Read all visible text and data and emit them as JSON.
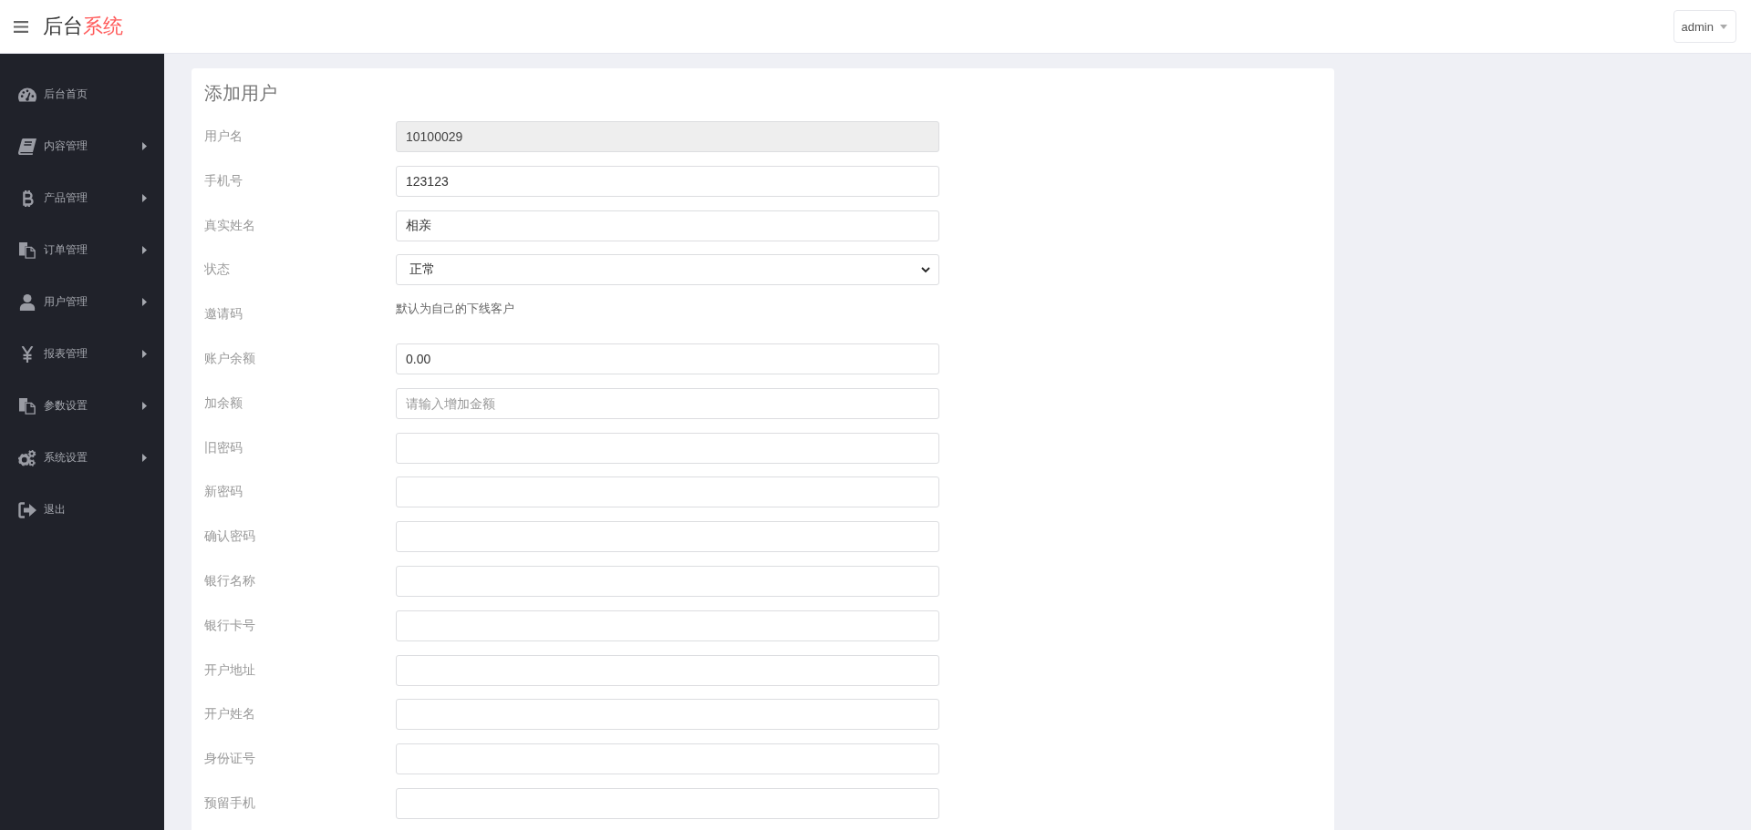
{
  "header": {
    "logo": {
      "text": "后台",
      "accent": "系统"
    },
    "user_menu": {
      "label": "admin"
    }
  },
  "sidebar": {
    "items": [
      {
        "label": "后台首页",
        "kind": "link"
      },
      {
        "label": "内容管理",
        "kind": "submenu"
      },
      {
        "label": "产品管理",
        "kind": "submenu"
      },
      {
        "label": "订单管理",
        "kind": "submenu"
      },
      {
        "label": "用户管理",
        "kind": "submenu"
      },
      {
        "label": "报表管理",
        "kind": "submenu"
      },
      {
        "label": "参数设置",
        "kind": "submenu"
      },
      {
        "label": "系统设置",
        "kind": "submenu"
      },
      {
        "label": "退出",
        "kind": "link"
      }
    ]
  },
  "form": {
    "title": "添加用户",
    "fields": [
      {
        "label": "用户名",
        "kind": "input",
        "value": "10100029",
        "disabled": true
      },
      {
        "label": "手机号",
        "kind": "input",
        "value": "123123",
        "disabled": false
      },
      {
        "label": "真实姓名",
        "kind": "input",
        "value": "相亲",
        "disabled": false
      },
      {
        "label": "状态",
        "kind": "select",
        "value": "正常",
        "disabled": false
      },
      {
        "label": "邀请码",
        "kind": "note",
        "text": "默认为自己的下线客户"
      },
      {
        "label": "账户余额",
        "kind": "input",
        "value": "0.00",
        "disabled": false
      },
      {
        "label": "加余额",
        "kind": "input",
        "placeholder": "请输入增加金额",
        "disabled": false
      },
      {
        "label": "旧密码",
        "kind": "input",
        "disabled": false
      },
      {
        "label": "新密码",
        "kind": "input",
        "disabled": false
      },
      {
        "label": "确认密码",
        "kind": "input",
        "disabled": false
      },
      {
        "label": "银行名称",
        "kind": "input",
        "disabled": false
      },
      {
        "label": "银行卡号",
        "kind": "input",
        "disabled": false
      },
      {
        "label": "开户地址",
        "kind": "input",
        "disabled": false
      },
      {
        "label": "开户姓名",
        "kind": "input",
        "disabled": false
      },
      {
        "label": "身份证号",
        "kind": "input",
        "disabled": false
      },
      {
        "label": "预留手机",
        "kind": "input",
        "disabled": false
      }
    ]
  }
}
